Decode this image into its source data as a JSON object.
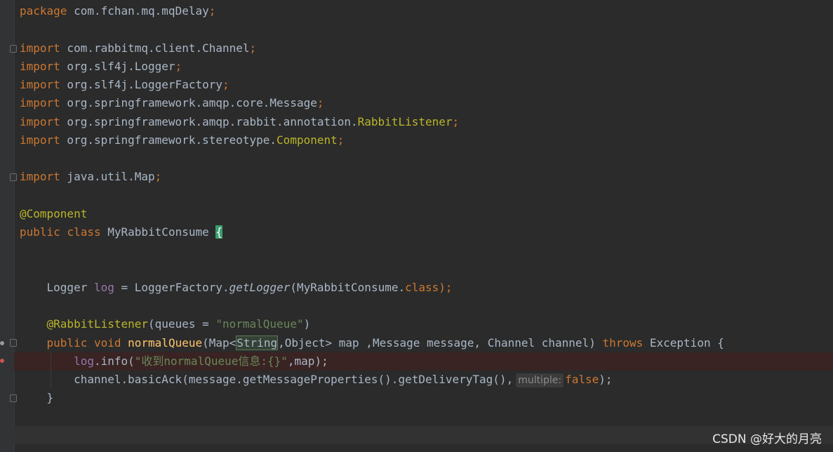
{
  "editor": {
    "lines": {
      "l1": {
        "kw": "package",
        "rest": " com.fchan.mq.mqDelay",
        "semi": ";"
      },
      "l3": {
        "kw": "import",
        "rest": " com.rabbitmq.client.Channel",
        "semi": ";"
      },
      "l4": {
        "kw": "import",
        "rest": " org.slf4j.Logger",
        "semi": ";"
      },
      "l5": {
        "kw": "import",
        "rest": " org.slf4j.LoggerFactory",
        "semi": ";"
      },
      "l6": {
        "kw": "import",
        "rest": " org.springframework.amqp.core.Message",
        "semi": ";"
      },
      "l7": {
        "kw": "import",
        "rest": " org.springframework.amqp.rabbit.annotation.",
        "cls": "RabbitListener",
        "semi": ";"
      },
      "l8": {
        "kw": "import",
        "rest": " org.springframework.stereotype.",
        "cls": "Component",
        "semi": ";"
      },
      "l10": {
        "kw": "import",
        "rest": " java.util.Map",
        "semi": ";"
      },
      "l12": {
        "ann": "@Component"
      },
      "l13": {
        "kw1": "public",
        "kw2": "class",
        "name": " MyRabbitConsume ",
        "brace": "{"
      },
      "l16": {
        "type": "Logger ",
        "field": "log",
        "eq": " = LoggerFactory.",
        "method": "getLogger",
        "args": "(MyRabbitConsume.",
        "kwclass": "class",
        "end": ");"
      },
      "l18": {
        "ann": "@RabbitListener",
        "open": "(queues = ",
        "str": "\"normalQueue\"",
        "close": ")"
      },
      "l19": {
        "kw1": "public",
        "kw2": "void",
        "method": "normalQueue",
        "p1": "(Map<",
        "match": "String",
        "p2": ",Object> map ,Message message, Channel channel) ",
        "kw3": "throws",
        "p3": " Exception {"
      },
      "l20": {
        "field": "log",
        "call": ".info(",
        "str": "\"收到normalQueue信息:{}\"",
        "rest": ",map);"
      },
      "l21": {
        "call": "channel.basicAck(message.getMessageProperties().getDeliveryTag(),",
        "hint": "multiple:",
        "kw": "false",
        "end": ");"
      },
      "l22": {
        "brace": "}"
      }
    }
  },
  "watermark": "CSDN @好大的月亮",
  "colors": {
    "background": "#2b2b2b",
    "keyword": "#cc7832",
    "annotation": "#bbb529",
    "string": "#6a8759",
    "field": "#9876aa",
    "method": "#ffc66d",
    "text": "#a9b7c6"
  }
}
